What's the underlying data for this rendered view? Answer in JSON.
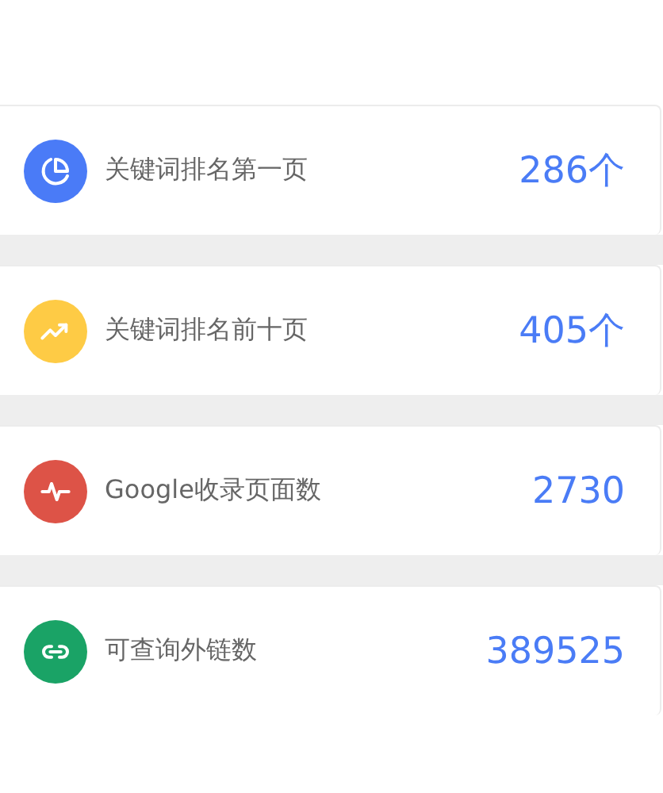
{
  "stats": [
    {
      "kind": "pie",
      "color": "#4a7bf7",
      "label": "关键词排名第一页",
      "value": "286个"
    },
    {
      "kind": "trend",
      "color": "#fecb45",
      "label": "关键词排名前十页",
      "value": "405个"
    },
    {
      "kind": "pulse",
      "color": "#dd5347",
      "label": "Google收录页面数",
      "value": "2730"
    },
    {
      "kind": "link",
      "color": "#1aa366",
      "label": "可查询外链数",
      "value": "389525"
    }
  ]
}
